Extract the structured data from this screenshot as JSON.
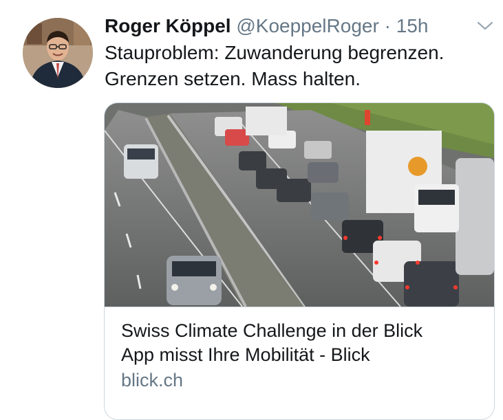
{
  "tweet": {
    "author_name": "Roger Köppel",
    "handle": "@KoeppelRoger",
    "separator": "·",
    "time": "15h",
    "text_line1": "Stauproblem: Zuwanderung begrenzen.",
    "text_line2": "Grenzen setzen. Mass halten.",
    "avatar_icon": "profile-photo",
    "menu_icon": "chevron-down-icon"
  },
  "card": {
    "image_icon": "traffic-jam-photo",
    "title_line1": "Swiss Climate Challenge in der Blick",
    "title_line2": "App misst Ihre Mobilität - Blick",
    "domain": "blick.ch"
  },
  "colors": {
    "text_primary": "#14171a",
    "text_secondary": "#657786",
    "border": "#ccd6dd"
  }
}
